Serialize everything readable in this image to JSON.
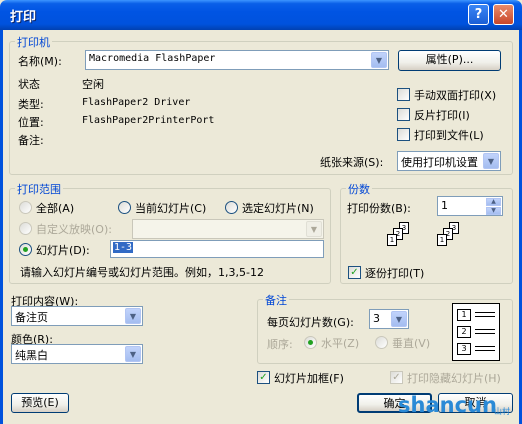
{
  "window": {
    "title": "打印",
    "help_glyph": "?",
    "close_glyph": "✕"
  },
  "printer": {
    "legend": "打印机",
    "name_label": "名称(M):",
    "name_value": "Macromedia FlashPaper",
    "properties_button": "属性(P)...",
    "status_label": "状态",
    "status_value": "空闲",
    "type_label": "类型:",
    "type_value": "FlashPaper2 Driver",
    "location_label": "位置:",
    "location_value": "FlashPaper2PrinterPort",
    "comment_label": "备注:",
    "manual_duplex": "手动双面打印(X)",
    "reverse_print": "反片打印(I)",
    "print_to_file": "打印到文件(L)",
    "paper_source_label": "纸张来源(S):",
    "paper_source_value": "使用打印机设置"
  },
  "print_range": {
    "legend": "打印范围",
    "all": "全部(A)",
    "current_slide": "当前幻灯片(C)",
    "selection": "选定幻灯片(N)",
    "custom_show": "自定义放映(O):",
    "slides": "幻灯片(D):",
    "slides_value": "1-3",
    "hint": "请输入幻灯片编号或幻灯片范围。例如，1,3,5-12"
  },
  "copies": {
    "legend": "份数",
    "count_label": "打印份数(B):",
    "count_value": "1",
    "collate": "逐份打印(T)",
    "page_labels": [
      "1",
      "2",
      "3"
    ]
  },
  "print_what": {
    "label": "打印内容(W):",
    "value": "备注页",
    "color_label": "颜色(R):",
    "color_value": "纯黑白"
  },
  "handouts": {
    "legend": "备注",
    "per_page_label": "每页幻灯片数(G):",
    "per_page_value": "3",
    "order_label": "顺序:",
    "horizontal": "水平(Z)",
    "vertical": "垂直(V)",
    "preview_numbers": [
      "1",
      "2",
      "3"
    ]
  },
  "options": {
    "frame_slides": "幻灯片加框(F)",
    "print_hidden": "打印隐藏幻灯片(H)"
  },
  "buttons": {
    "preview": "预览(E)",
    "ok": "确定",
    "cancel": "取消"
  },
  "watermark": {
    "text": "shancun",
    "subtext": "山村"
  }
}
